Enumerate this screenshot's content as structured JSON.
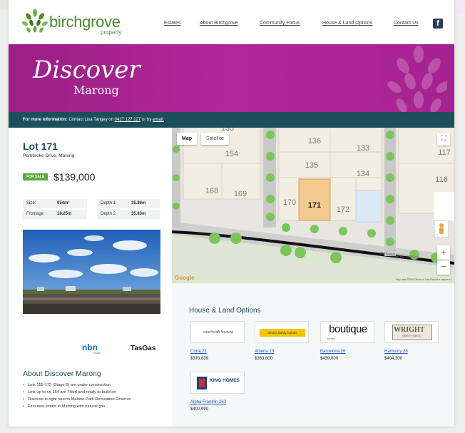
{
  "brand": {
    "name": "birchgrove",
    "sub": "property"
  },
  "nav": [
    "Estates",
    "About Birchgrove",
    "Community Focus",
    "House & Land Options",
    "Contact Us"
  ],
  "facebook_icon": "facebook-icon",
  "banner": {
    "line1": "Discover",
    "line2": "Marong"
  },
  "info": {
    "lead": "For more information:",
    "text": " Contact Lisa Tangey on ",
    "phone": "0417 127 127",
    "or": " or by ",
    "email": "email."
  },
  "lot": {
    "title": "Lot 171",
    "address": "Pembroke Drive, Marong",
    "badge": "FOR SALE",
    "price": "$139,000",
    "specs": [
      {
        "label": "Size:",
        "value": "654m²"
      },
      {
        "label": "Depth 1",
        "value": "35.86m"
      },
      {
        "label": "Frontage",
        "value": "18.25m"
      },
      {
        "label": "Depth 2",
        "value": "35.83m"
      }
    ]
  },
  "partners": {
    "nbn": "nbn",
    "nbn_sub": "ready",
    "tas": "TasGas"
  },
  "about": {
    "title": "About Discover Marong",
    "items": [
      "Lots 155-172 (Stage 6) are under construction",
      "Lots up to no 154 are Titled and ready to build on",
      "Discover is right next to Malone Park Recreation Reserve",
      "First new estate in Marong with natural gas"
    ]
  },
  "map": {
    "tab_map": "Map",
    "tab_satellite": "Satellite",
    "lots": [
      "135",
      "136",
      "133",
      "154",
      "117",
      "135",
      "134",
      "168",
      "169",
      "116",
      "170",
      "171",
      "172"
    ],
    "street": "PEMBROKE DRIVE",
    "google": "Google",
    "footer": "Map data ©2019  Terms of Use  Report a map error"
  },
  "house_land": {
    "title": "House & Land Options",
    "builders": [
      {
        "logo": "coachcraft housing",
        "name": "Coral 21",
        "price": "$370,639"
      },
      {
        "logo": "dennis family homes",
        "name": "Alberta 19",
        "price": "$363,800"
      },
      {
        "logo": "boutique",
        "logo_sub": "homes",
        "name": "Barcelona 26",
        "price": "$439,000"
      },
      {
        "logo": "WRIGHT",
        "logo_sub": "FAMILY HOMES",
        "name": "Harmony 28",
        "price": "$404,300"
      },
      {
        "logo": "KING HOMES",
        "name": "Alpha Franklin 263",
        "price": "$402,990"
      }
    ]
  },
  "colors": {
    "brand_green": "#4a8c2a",
    "banner_magenta": "#a52291",
    "info_teal": "#1c4f5a",
    "sale_green": "#5ea842",
    "selected_lot": "#f3c98f"
  }
}
